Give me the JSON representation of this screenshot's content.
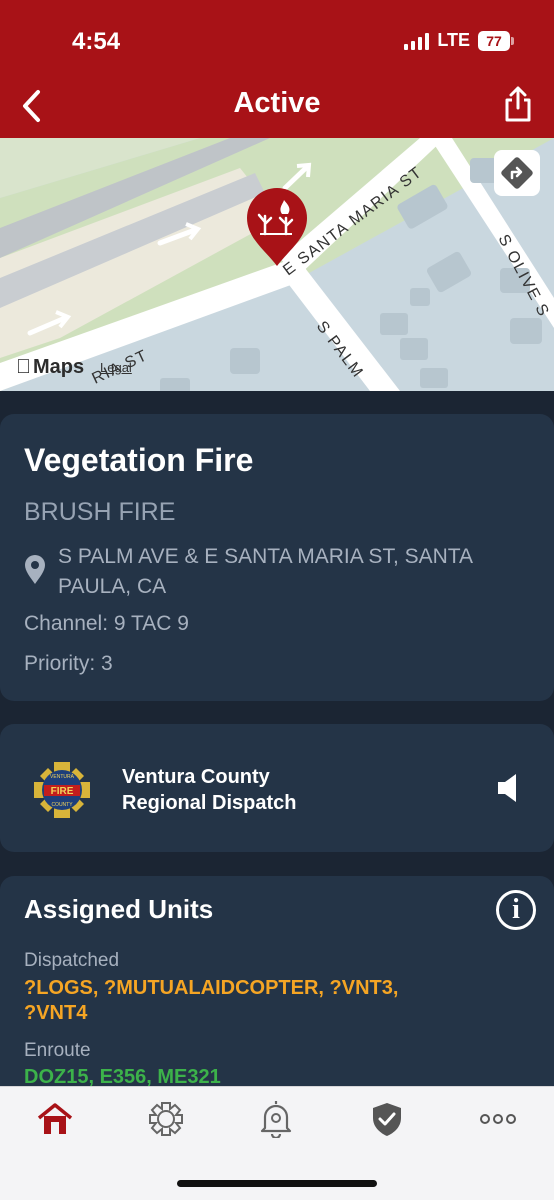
{
  "status": {
    "time": "4:54",
    "network": "LTE",
    "battery": "77"
  },
  "nav": {
    "title": "Active"
  },
  "map": {
    "streets": [
      "E SANTA MARIA ST",
      "S PALM",
      "S OLIVE S",
      "RIA ST"
    ],
    "maps_label": "Maps",
    "legal_label": "Legal"
  },
  "incident": {
    "title": "Vegetation Fire",
    "subtitle": "BRUSH FIRE",
    "location": "S PALM AVE & E SANTA MARIA ST, SANTA PAULA, CA",
    "channel": "Channel: 9 TAC 9",
    "priority": "Priority: 3"
  },
  "dispatch": {
    "name_line1": "Ventura County",
    "name_line2": "Regional Dispatch",
    "badge_top": "VENTURA",
    "badge_mid": "FIRE",
    "badge_bottom": "COUNTY"
  },
  "units": {
    "title": "Assigned Units",
    "dispatched_label": "Dispatched",
    "dispatched_units": "?LOGS, ?MUTUALAIDCOPTER, ?VNT3, ?VNT4",
    "enroute_label": "Enroute",
    "enroute_units": "DOZ15, E356, ME321"
  },
  "tabs": [
    "home-icon",
    "fire-badge-icon",
    "alert-bell-icon",
    "shield-check-icon",
    "more-icon"
  ],
  "colors": {
    "brand_red": "#a81217",
    "card_bg": "#243447",
    "dispatched": "#f5a524",
    "enroute": "#3cb24a",
    "active_tab": "#a81217"
  }
}
